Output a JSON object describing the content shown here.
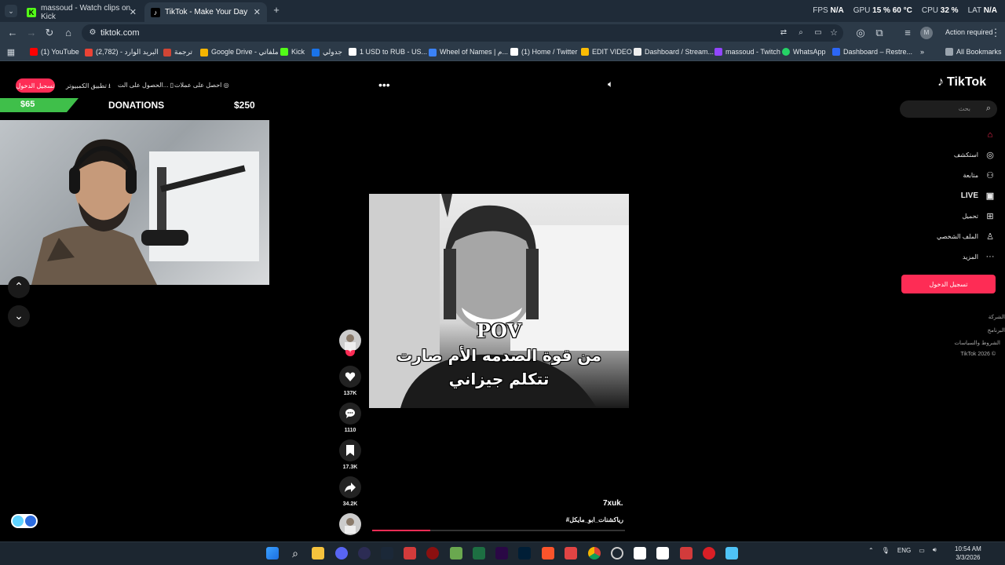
{
  "browser": {
    "tabs": [
      {
        "title": "massoud - Watch clips on Kick",
        "active": false
      },
      {
        "title": "TikTok - Make Your Day",
        "active": true
      }
    ],
    "perf": {
      "fps_label": "FPS",
      "fps_value": "N/A",
      "gpu_label": "GPU",
      "gpu_value": "15 % 60 °C",
      "cpu_label": "CPU",
      "cpu_value": "32 %",
      "lat_label": "LAT",
      "lat_value": "N/A"
    },
    "url": "tiktok.com",
    "profile_initial": "M",
    "action_required": "Action required",
    "bookmarks": [
      "(1) YouTube",
      "البريد الوارد - (2,782)",
      "ترجمة",
      "Google Drive - ملفاتي",
      "Kick",
      "جدولي",
      "1 USD to RUB - US...",
      "Wheel of Names | م...",
      "(1) Home / Twitter",
      "EDIT VIDEO",
      "Dashboard / Stream...",
      "massoud - Twitch",
      "WhatsApp",
      "Dashboard – Restre..."
    ],
    "all_bookmarks": "All Bookmarks"
  },
  "tiktok": {
    "top": {
      "login": "تسجيل الدخول",
      "get_coins": "احصل على عملات",
      "get_app": "الحصول على الت...",
      "desktop_app": "تطبيق الكمبيوتر"
    },
    "logo": "TikTok",
    "search_placeholder": "بحث",
    "nav": [
      {
        "label": "",
        "icon": "home-icon"
      },
      {
        "label": "استكشف",
        "icon": "compass-icon"
      },
      {
        "label": "متابعة",
        "icon": "follow-user-icon"
      },
      {
        "label": "LIVE",
        "icon": "live-icon"
      },
      {
        "label": "تحميل",
        "icon": "upload-icon"
      },
      {
        "label": "الملف الشخصي",
        "icon": "profile-icon"
      },
      {
        "label": "المزيد",
        "icon": "more-icon"
      }
    ],
    "sidebar_login": "تسجيل الدخول",
    "footer": [
      "الشركة",
      "البرنامج",
      "الشروط والسياسات",
      "TikTok 2026 ©"
    ],
    "video": {
      "caption_pov": "POV",
      "caption_line1": "من قوة الصدمه الأم صارت",
      "caption_line2": "تتكلم جيزاني",
      "author": "7xuk.",
      "hashtag": "#رياكشنات_ابو_مايكل",
      "progress": 0.23
    },
    "actions": [
      {
        "name": "like",
        "count": "137K"
      },
      {
        "name": "comment",
        "count": "1110"
      },
      {
        "name": "bookmark",
        "count": "17.3K"
      },
      {
        "name": "share",
        "count": "34.2K"
      }
    ]
  },
  "overlay": {
    "donation_current": "$65",
    "donation_title": "DONATIONS",
    "donation_goal": "$250"
  },
  "taskbar": {
    "language": "ENG",
    "time": "10:54 AM",
    "date": "3/3/2026"
  }
}
